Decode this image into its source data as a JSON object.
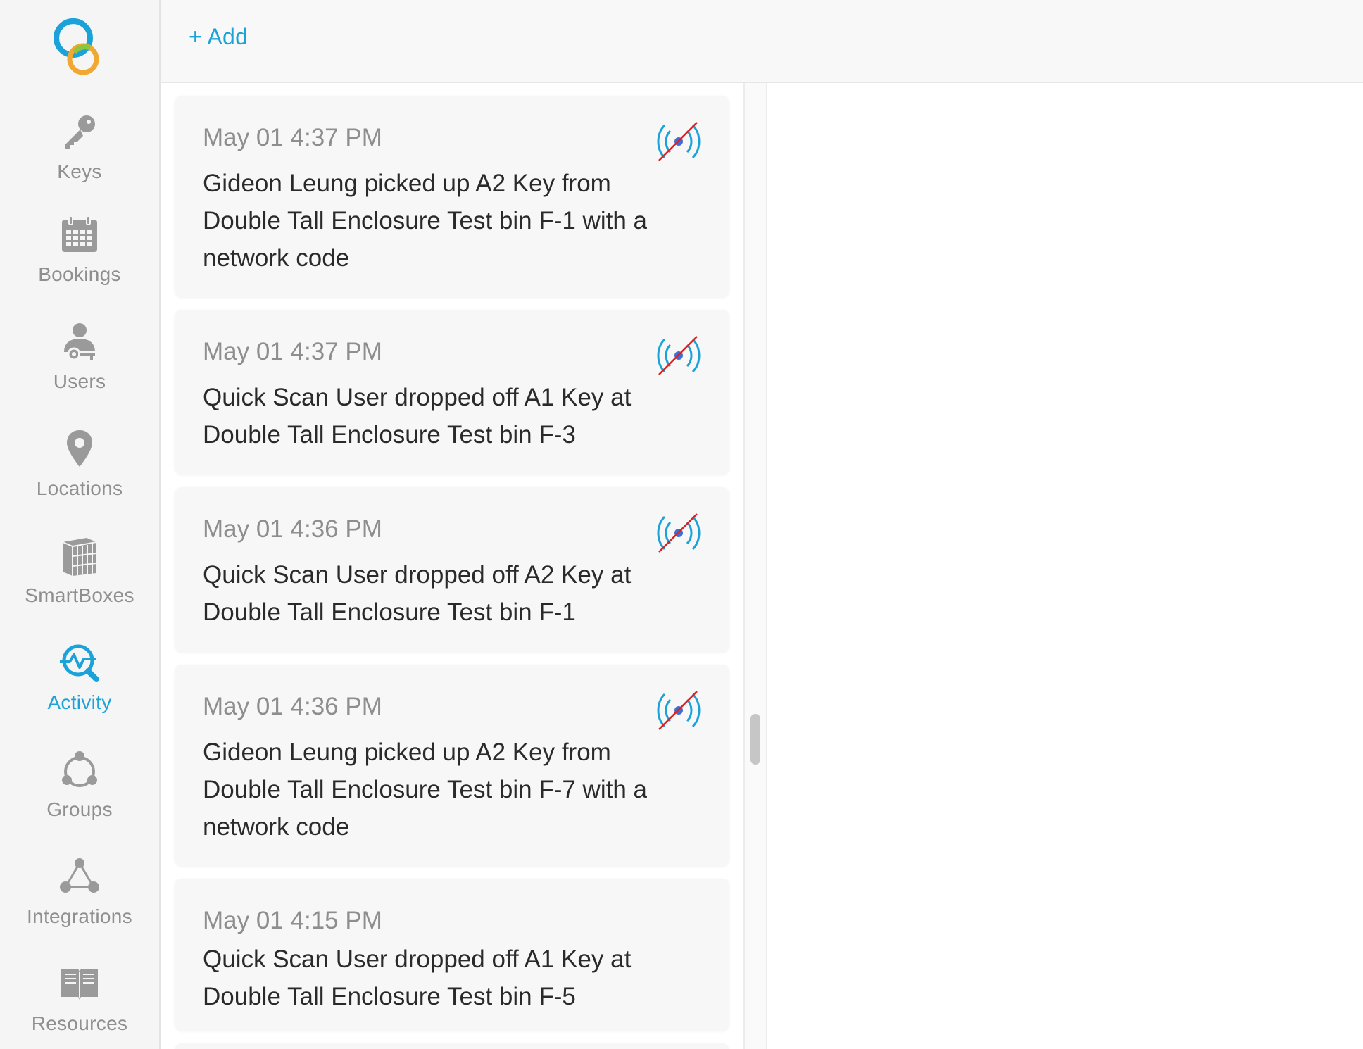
{
  "colors": {
    "accent": "#1ba3d9",
    "muted": "#8f8f8f",
    "no_network_slash": "#e02020"
  },
  "sidebar": {
    "logo_icon": "rings-logo-icon",
    "items": [
      {
        "label": "Keys",
        "icon": "key-icon",
        "active": false
      },
      {
        "label": "Bookings",
        "icon": "calendar-icon",
        "active": false
      },
      {
        "label": "Users",
        "icon": "user-key-icon",
        "active": false
      },
      {
        "label": "Locations",
        "icon": "map-pin-icon",
        "active": false
      },
      {
        "label": "SmartBoxes",
        "icon": "smartbox-icon",
        "active": false
      },
      {
        "label": "Activity",
        "icon": "activity-search-icon",
        "active": true
      },
      {
        "label": "Groups",
        "icon": "groups-icon",
        "active": false
      },
      {
        "label": "Integrations",
        "icon": "integrations-icon",
        "active": false
      },
      {
        "label": "Resources",
        "icon": "book-icon",
        "active": false
      }
    ]
  },
  "header": {
    "add_label": "+ Add"
  },
  "feed": {
    "items": [
      {
        "time": "May 01 4:37 PM",
        "text": "Gideon Leung picked up A2 Key from Double Tall Enclosure Test bin F-1 with a network code",
        "icon": "no-network-icon"
      },
      {
        "time": "May 01 4:37 PM",
        "text": "Quick Scan User dropped off A1 Key at Double Tall Enclosure Test bin F-3",
        "icon": "no-network-icon"
      },
      {
        "time": "May 01 4:36 PM",
        "text": "Quick Scan User dropped off A2 Key at Double Tall Enclosure Test bin F-1",
        "icon": "no-network-icon"
      },
      {
        "time": "May 01 4:36 PM",
        "text": "Gideon Leung picked up A2 Key from Double Tall Enclosure Test bin F-7 with a network code",
        "icon": "no-network-icon"
      },
      {
        "time": "May 01 4:15 PM",
        "text": "Quick Scan User dropped off A1 Key at Double Tall Enclosure Test bin F-5",
        "icon": null
      }
    ]
  }
}
